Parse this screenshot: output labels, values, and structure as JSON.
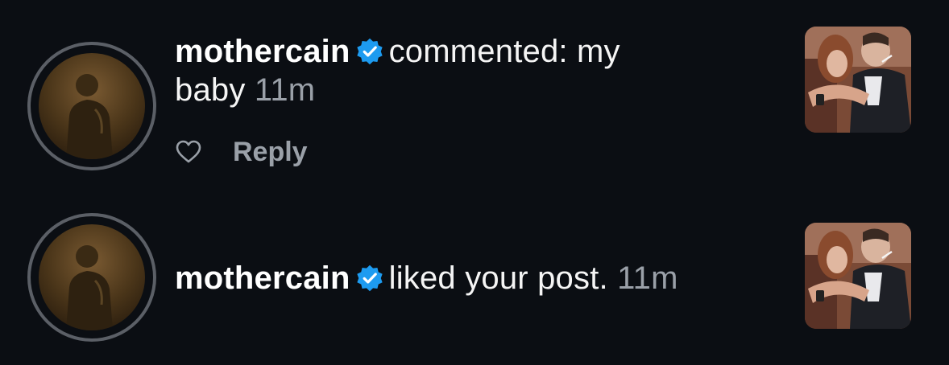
{
  "notifications": [
    {
      "username": "mothercain",
      "action": "commented: my baby",
      "time": "11m",
      "reply_label": "Reply",
      "avatar_icon": "avatar-photo",
      "verified_icon": "verified-badge-icon",
      "like_icon": "heart-outline-icon",
      "thumbnail_icon": "post-thumbnail"
    },
    {
      "username": "mothercain",
      "action": "liked your post.",
      "time": "11m",
      "avatar_icon": "avatar-photo",
      "verified_icon": "verified-badge-icon",
      "thumbnail_icon": "post-thumbnail"
    }
  ],
  "colors": {
    "background": "#0b0e13",
    "text_primary": "#ffffff",
    "text_secondary": "#9aa0a8",
    "verified_blue": "#1d9bf0",
    "avatar_ring": "#5b5f66"
  }
}
